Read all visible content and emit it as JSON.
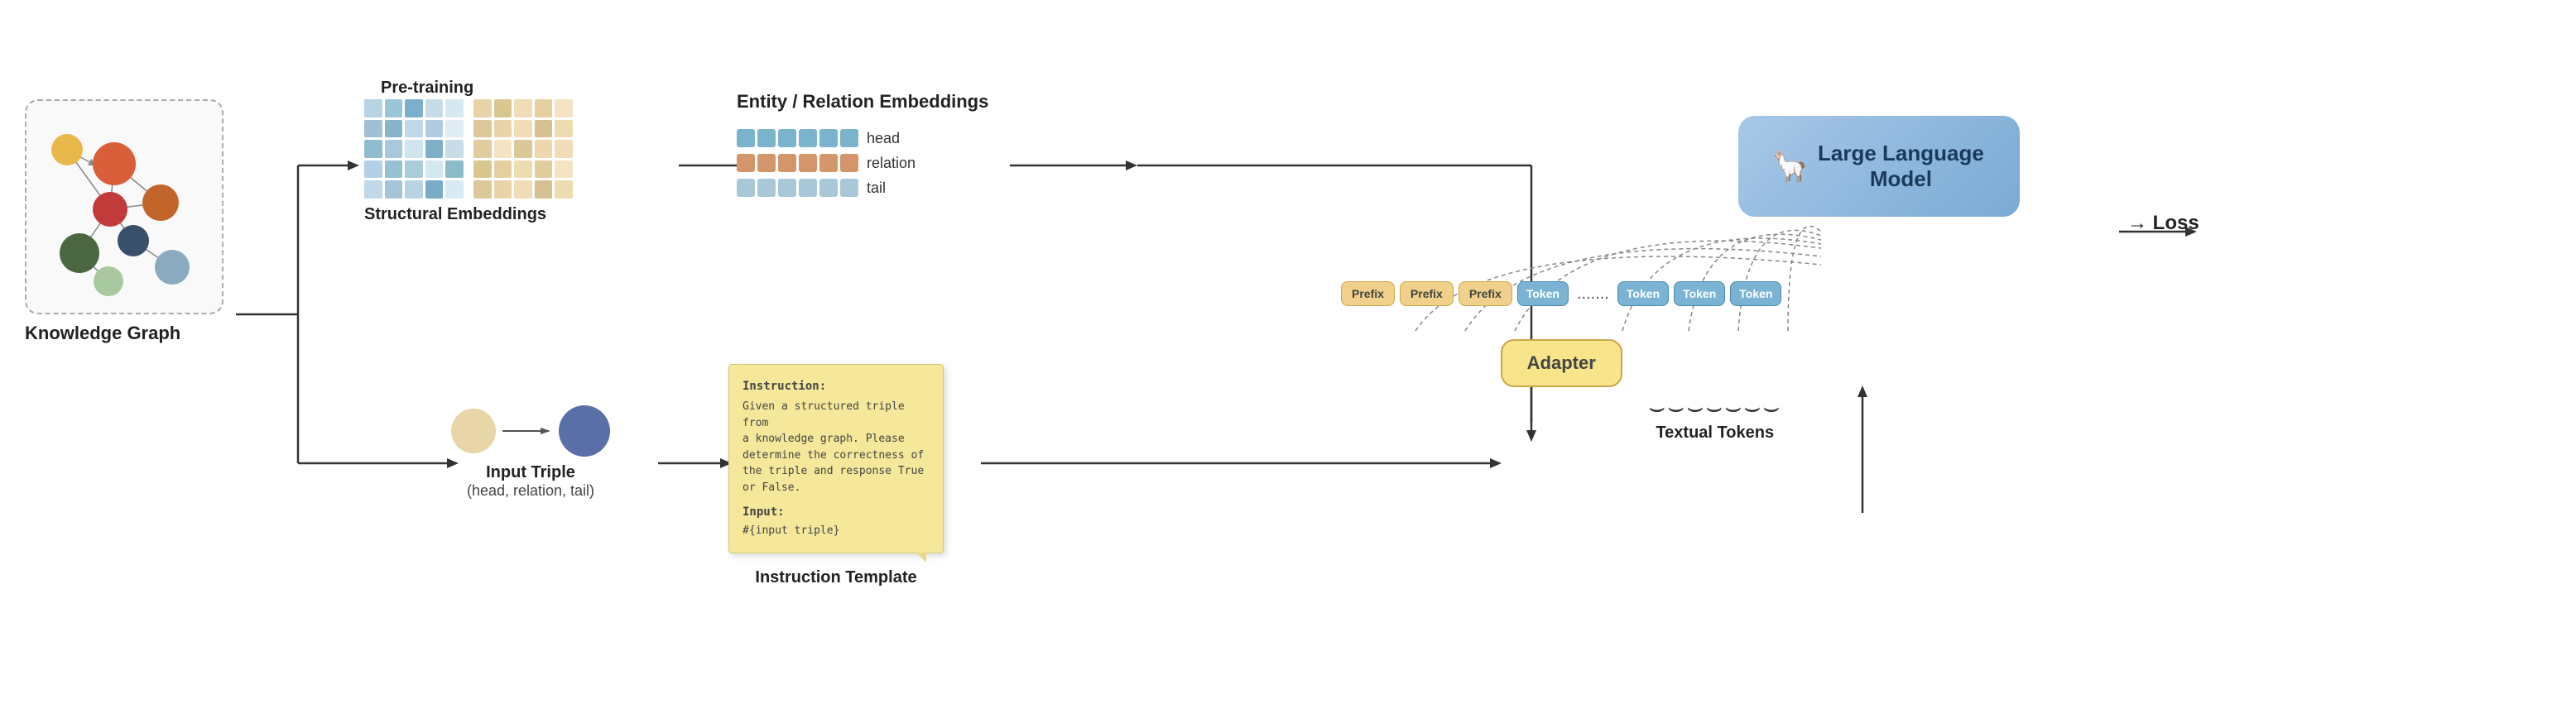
{
  "labels": {
    "knowledge_graph": "Knowledge Graph",
    "pre_training": "Pre-training",
    "structural_embeddings": "Structural Embeddings",
    "input_triple": "Input Triple",
    "input_triple_sub": "(head, relation, tail)",
    "entity_relation_embeddings": "Entity / Relation Embeddings",
    "instruction_template": "Instruction Template",
    "adapter": "Adapter",
    "textual_tokens": "Textual Tokens",
    "large_language_model": "Large Language Model",
    "loss": "→ Loss",
    "head": "head",
    "relation": "relation",
    "tail": "tail",
    "prefix": "Prefix",
    "token": "Token",
    "dots": ".......",
    "instruction_title": "Instruction:",
    "instruction_body": "Given a structured triple from\na knowledge graph. Please\ndetermine the correctness of\nthe triple and response True\nor False.",
    "input_title": "Input:",
    "input_body": "#{input triple}"
  },
  "colors": {
    "head_color": "#7ab3cc",
    "relation_color": "#d4956a",
    "tail_color": "#a8c8d8",
    "prefix_bg": "#f0d08a",
    "token_bg": "#7ab3d4",
    "adapter_bg": "#f8e48a",
    "llm_bg": "#a8c8e8",
    "sticky_bg": "#f5e89a"
  },
  "grid1_colors": [
    "#b8d4e4",
    "#9ac4d8",
    "#7ab0cc",
    "#c8dce8",
    "#d8e8f0",
    "#a0c0d4",
    "#88b4cc",
    "#c0d8e8",
    "#b0cce0",
    "#e0ecf4",
    "#90bcd0",
    "#a8c8dc",
    "#d0e4ef",
    "#80b0c8",
    "#c8dce8",
    "#b4d0e4",
    "#98c0d4",
    "#aaccd8",
    "#d4e8f0",
    "#8cbcc8",
    "#c0d8e8",
    "#a4c4d8",
    "#b8d4e4",
    "#7aacca",
    "#d8eaf4"
  ],
  "grid2_colors": [
    "#e8d4a8",
    "#d8c890",
    "#f0ddb8",
    "#e4cfa0",
    "#f4e4c4",
    "#dcc898",
    "#e8d4a8",
    "#f0ddb8",
    "#d4c090",
    "#ecddb0",
    "#e0cc9c",
    "#f4e4c4",
    "#dac898",
    "#ecd8ac",
    "#f0ddb8",
    "#d8c890",
    "#e4cfa0",
    "#ecddb0",
    "#e0cc9c",
    "#f4e4c4",
    "#dcc898",
    "#e8d4a8",
    "#f0ddb8",
    "#d4c090",
    "#ecddb0"
  ]
}
